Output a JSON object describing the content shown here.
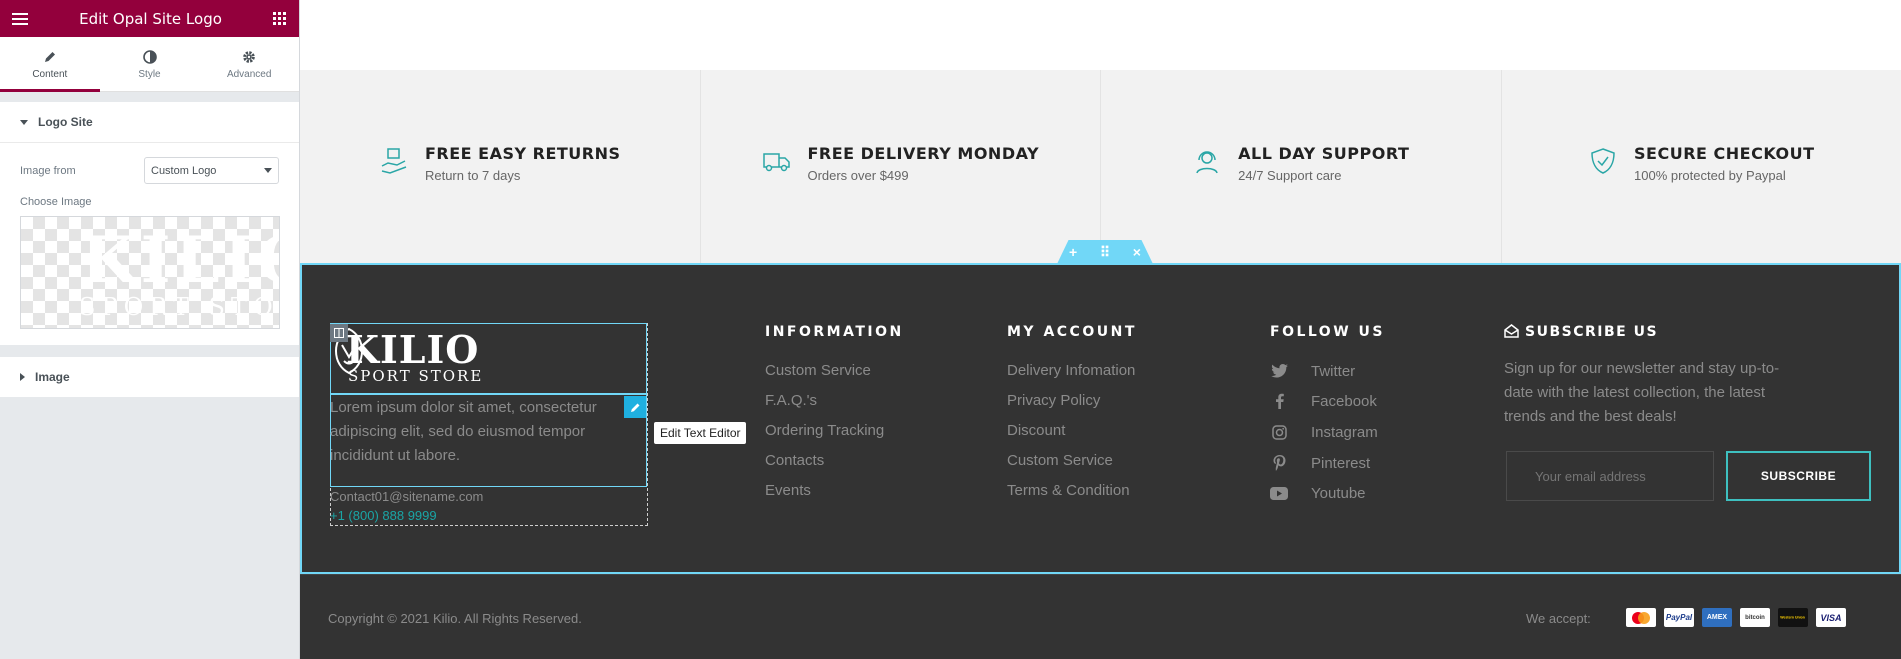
{
  "editor": {
    "title": "Edit Opal Site Logo",
    "tabs": [
      {
        "label": "Content",
        "icon": "pencil-icon"
      },
      {
        "label": "Style",
        "icon": "contrast-icon"
      },
      {
        "label": "Advanced",
        "icon": "gear-icon"
      }
    ],
    "logo_section": {
      "title": "Logo Site",
      "image_from_label": "Image from",
      "image_from_value": "Custom Logo",
      "choose_image_label": "Choose Image",
      "preview_line1": "KILIO",
      "preview_line2": "SPORT STO"
    },
    "image_section": {
      "title": "Image"
    }
  },
  "features": [
    {
      "title": "FREE EASY RETURNS",
      "subtitle": "Return to 7 days",
      "icon": "return-box-icon"
    },
    {
      "title": "FREE DELIVERY MONDAY",
      "subtitle": "Orders over $499",
      "icon": "delivery-truck-icon"
    },
    {
      "title": "ALL DAY SUPPORT",
      "subtitle": "24/7 Support care",
      "icon": "support-headset-icon"
    },
    {
      "title": "SECURE CHECKOUT",
      "subtitle": "100% protected by Paypal",
      "icon": "shield-check-icon"
    }
  ],
  "section_handle": {
    "add": "+",
    "move": "⠿",
    "close": "×"
  },
  "footer": {
    "logo_name": "KILIO",
    "logo_sub": "SPORT STORE",
    "about": "Lorem ipsum dolor sit amet, consectetur adipiscing elit, sed do eiusmod tempor incididunt ut labore.",
    "tooltip": "Edit Text Editor",
    "email": "Contact01@sitename.com",
    "phone": "+1 (800) 888 9999",
    "information": {
      "title": "INFORMATION",
      "links": [
        "Custom Service",
        "F.A.Q.'s",
        "Ordering Tracking",
        "Contacts",
        "Events"
      ]
    },
    "account": {
      "title": "MY ACCOUNT",
      "links": [
        "Delivery Infomation",
        "Privacy Policy",
        "Discount",
        "Custom Service",
        "Terms & Condition"
      ]
    },
    "follow": {
      "title": "FOLLOW US",
      "items": [
        {
          "label": "Twitter",
          "icon": "twitter-icon"
        },
        {
          "label": "Facebook",
          "icon": "facebook-icon"
        },
        {
          "label": "Instagram",
          "icon": "instagram-icon"
        },
        {
          "label": "Pinterest",
          "icon": "pinterest-icon"
        },
        {
          "label": "Youtube",
          "icon": "youtube-icon"
        }
      ]
    },
    "subscribe": {
      "title": "SUBSCRIBE US",
      "text": "Sign up for our newsletter and stay up-to-date with the latest collection, the latest trends and the best deals!",
      "placeholder": "Your email address",
      "button": "SUBSCRIBE"
    }
  },
  "bottom": {
    "copyright": "Copyright © 2021 Kilio. All Rights Reserved.",
    "we_accept": "We accept:",
    "cards": [
      "MasterCard",
      "PayPal",
      "AMEX",
      "bitcoin",
      "Western Union",
      "VISA"
    ]
  },
  "colors": {
    "brand": "#93003c",
    "accent": "#3ec0c0",
    "editor_highlight": "#71d7f7",
    "footer_bg": "#333333"
  }
}
